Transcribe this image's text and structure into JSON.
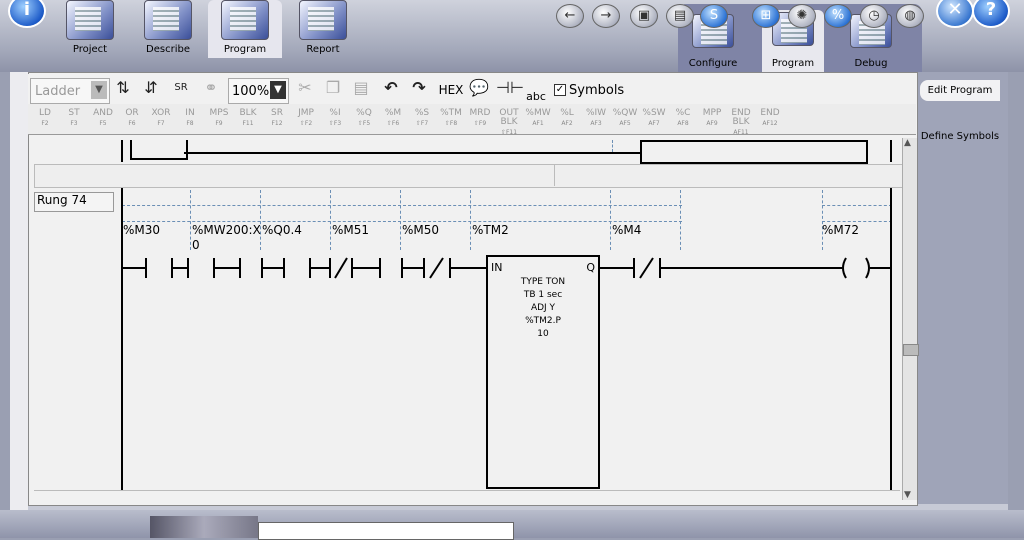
{
  "app_tabs": [
    "Project",
    "Describe",
    "Program",
    "Report"
  ],
  "right_tabs": [
    "Configure",
    "Program",
    "Debug"
  ],
  "top_buttons": {
    "info": "i",
    "help": "?"
  },
  "toolbar": {
    "view_select": "Ladder",
    "zoom": "100%",
    "hex": "HEX",
    "abc": "abc",
    "symbols_label": "Symbols",
    "symbols_checked": true
  },
  "instruction_keys": [
    {
      "label": "LD",
      "key": "F2"
    },
    {
      "label": "ST",
      "key": "F3"
    },
    {
      "label": "AND",
      "key": "F5"
    },
    {
      "label": "OR",
      "key": "F6"
    },
    {
      "label": "XOR",
      "key": "F7"
    },
    {
      "label": "IN",
      "key": "F8"
    },
    {
      "label": "MPS",
      "key": "F9"
    },
    {
      "label": "BLK",
      "key": "F11"
    },
    {
      "label": "SR",
      "key": "F12"
    },
    {
      "label": "JMP",
      "key": "⇧F2"
    },
    {
      "label": "%I",
      "key": "⇧F3"
    },
    {
      "label": "%Q",
      "key": "⇧F5"
    },
    {
      "label": "%M",
      "key": "⇧F6"
    },
    {
      "label": "%S",
      "key": "⇧F7"
    },
    {
      "label": "%TM",
      "key": "⇧F8"
    },
    {
      "label": "MRD",
      "key": "⇧F9"
    },
    {
      "label": "OUT BLK",
      "key": "⇧F11"
    },
    {
      "label": "%MW",
      "key": "AF1"
    },
    {
      "label": "%L",
      "key": "AF2"
    },
    {
      "label": "%IW",
      "key": "AF3"
    },
    {
      "label": "%QW",
      "key": "AF5"
    },
    {
      "label": "%SW",
      "key": "AF7"
    },
    {
      "label": "%C",
      "key": "AF8"
    },
    {
      "label": "MPP",
      "key": "AF9"
    },
    {
      "label": "END BLK",
      "key": "AF11"
    },
    {
      "label": "END",
      "key": "AF12"
    }
  ],
  "side_buttons": {
    "edit_program": "Edit Program",
    "define_symbols": "Define Symbols"
  },
  "rung": {
    "label": "Rung 74",
    "variables": [
      "%M30",
      "%MW200:X",
      "0",
      "%Q0.4",
      "%M51",
      "%M50",
      "%TM2",
      "%M4",
      "%M72"
    ],
    "timer": {
      "in": "IN",
      "q": "Q",
      "type": "TYPE  TON",
      "tb": "TB      1 sec",
      "adj": "ADJ       Y",
      "preset_var": "%TM2.P",
      "preset": "10"
    }
  }
}
